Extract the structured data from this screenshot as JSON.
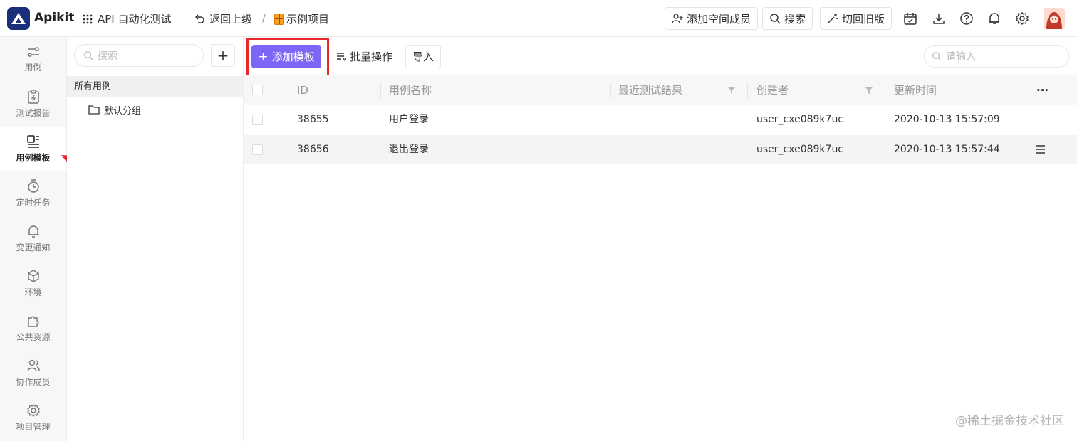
{
  "topbar": {
    "brand": "Apikit",
    "app_name": "API 自动化测试",
    "back_label": "返回上级",
    "separator": "/",
    "project_name": "示例项目",
    "add_member_label": "添加空间成员",
    "search_label": "搜索",
    "switch_old_label": "切回旧版",
    "icons": [
      "calendar-icon",
      "download-icon",
      "help-icon",
      "bell-icon",
      "settings-icon"
    ]
  },
  "sidebar": {
    "items": [
      {
        "label": "用例",
        "icon": "case-icon"
      },
      {
        "label": "测试报告",
        "icon": "report-icon"
      },
      {
        "label": "用例模板",
        "icon": "template-icon",
        "active": true
      },
      {
        "label": "定时任务",
        "icon": "timer-icon"
      },
      {
        "label": "变更通知",
        "icon": "bell-icon"
      },
      {
        "label": "环境",
        "icon": "cube-icon"
      },
      {
        "label": "公共资源",
        "icon": "puzzle-icon"
      },
      {
        "label": "协作成员",
        "icon": "members-icon"
      },
      {
        "label": "项目管理",
        "icon": "gear-icon"
      }
    ]
  },
  "tree": {
    "search_placeholder": "搜索",
    "add_label": "+",
    "all_label": "所有用例",
    "group_label": "默认分组"
  },
  "toolbar": {
    "add_template_label": "添加模板",
    "batch_label": "批量操作",
    "import_label": "导入",
    "search_placeholder": "请输入"
  },
  "table": {
    "columns": [
      "ID",
      "用例名称",
      "最近测试结果",
      "创建者",
      "更新时间"
    ],
    "rows": [
      {
        "id": "38655",
        "name": "用户登录",
        "result": "",
        "creator": "user_cxe089k7uc",
        "updated": "2020-10-13 15:57:09"
      },
      {
        "id": "38656",
        "name": "退出登录",
        "result": "",
        "creator": "user_cxe089k7uc",
        "updated": "2020-10-13 15:57:44"
      }
    ]
  },
  "watermark": "@稀土掘金技术社区",
  "colors": {
    "primary": "#7b66f6",
    "highlight": "#e8282b",
    "logo": "#1a2e7a"
  }
}
